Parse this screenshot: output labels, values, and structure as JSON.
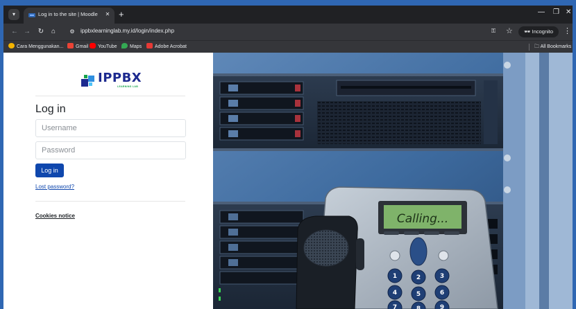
{
  "browser": {
    "tab_title": "Log in to the site | Moodle Dem",
    "url": "ippbxlearninglab.my.id/login/index.php",
    "incognito_label": "Incognito",
    "all_bookmarks_label": "All Bookmarks",
    "bookmarks": [
      {
        "label": "Cara Menggunakan...",
        "icon": "folder-icon",
        "color": "#f4b400"
      },
      {
        "label": "Gmail",
        "icon": "gmail-icon",
        "color": "#ea4335"
      },
      {
        "label": "YouTube",
        "icon": "youtube-icon",
        "color": "#ff0000"
      },
      {
        "label": "Maps",
        "icon": "maps-icon",
        "color": "#34a853"
      },
      {
        "label": "Adobe Acrobat",
        "icon": "acrobat-icon",
        "color": "#e53935"
      }
    ]
  },
  "login": {
    "logo_text": "IPPBX",
    "logo_subtext": "LEARNING LAB",
    "heading": "Log in",
    "username_placeholder": "Username",
    "password_placeholder": "Password",
    "login_button": "Log in",
    "lost_password": "Lost password?",
    "cookies_notice": "Cookies notice"
  },
  "hero": {
    "phone_display_text": "Calling..."
  },
  "colors": {
    "primary": "#0f47ad",
    "logo_blue": "#1d2a8f",
    "chrome_dark": "#202124",
    "chrome_toolbar": "#35363a",
    "window_border": "#2f67b3"
  }
}
